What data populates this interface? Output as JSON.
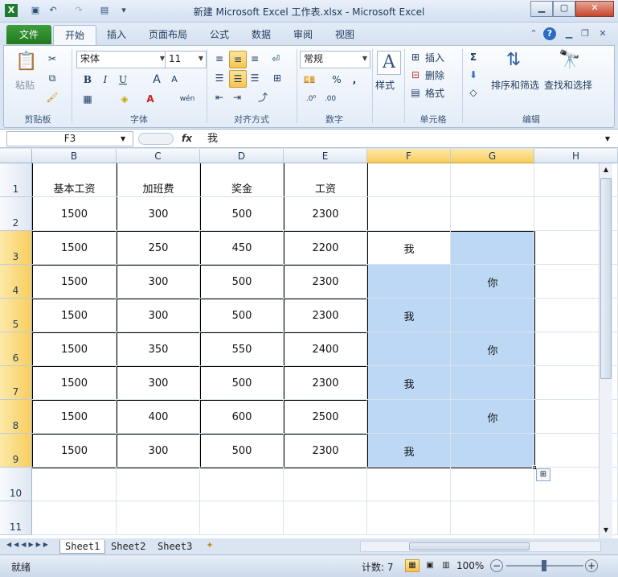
{
  "window": {
    "title": "新建 Microsoft Excel 工作表.xlsx  -  Microsoft Excel"
  },
  "tabs": [
    "文件",
    "开始",
    "插入",
    "页面布局",
    "公式",
    "数据",
    "审阅",
    "视图"
  ],
  "ribbon": {
    "clipboard": {
      "paste": "粘贴",
      "group": "剪贴板"
    },
    "font": {
      "name": "宋体",
      "size": "11",
      "bold": "B",
      "italic": "I",
      "underline": "U",
      "grow": "A",
      "shrink": "A",
      "group": "字体",
      "phonetic": "wén"
    },
    "alignment": {
      "group": "对齐方式"
    },
    "number": {
      "format": "常规",
      "percent": "%",
      "comma": ",",
      "group": "数字"
    },
    "styles": {
      "label": "样式"
    },
    "cells": {
      "insert": "插入",
      "delete": "删除",
      "format": "格式",
      "group": "单元格"
    },
    "editing": {
      "sigma": "Σ",
      "sort": "排序和筛选",
      "find": "查找和选择",
      "group": "编辑"
    }
  },
  "formula_bar": {
    "name_box": "F3",
    "fx": "fx",
    "content": "我"
  },
  "columns": [
    "B",
    "C",
    "D",
    "E",
    "F",
    "G",
    "H"
  ],
  "rows": [
    "1",
    "2",
    "3",
    "4",
    "5",
    "6",
    "7",
    "8",
    "9",
    "10",
    "11"
  ],
  "headers_row": [
    "基本工资",
    "加班费",
    "奖金",
    "工资"
  ],
  "table": [
    [
      "1500",
      "300",
      "500",
      "2300"
    ],
    [
      "1500",
      "250",
      "450",
      "2200"
    ],
    [
      "1500",
      "300",
      "500",
      "2300"
    ],
    [
      "1500",
      "300",
      "500",
      "2300"
    ],
    [
      "1500",
      "350",
      "550",
      "2400"
    ],
    [
      "1500",
      "300",
      "500",
      "2300"
    ],
    [
      "1500",
      "400",
      "600",
      "2500"
    ],
    [
      "1500",
      "300",
      "500",
      "2300"
    ]
  ],
  "extra_cells": {
    "f3": "我",
    "g4": "你",
    "f5": "我",
    "g6": "你",
    "f7": "我",
    "g8": "你",
    "f9": "我"
  },
  "sheets": [
    "Sheet1",
    "Sheet2",
    "Sheet3"
  ],
  "status": {
    "ready": "就绪",
    "count": "计数: 7",
    "zoom": "100%"
  },
  "colors": {
    "selection": "#bcd8f5",
    "file_tab": "#2a8a29"
  }
}
